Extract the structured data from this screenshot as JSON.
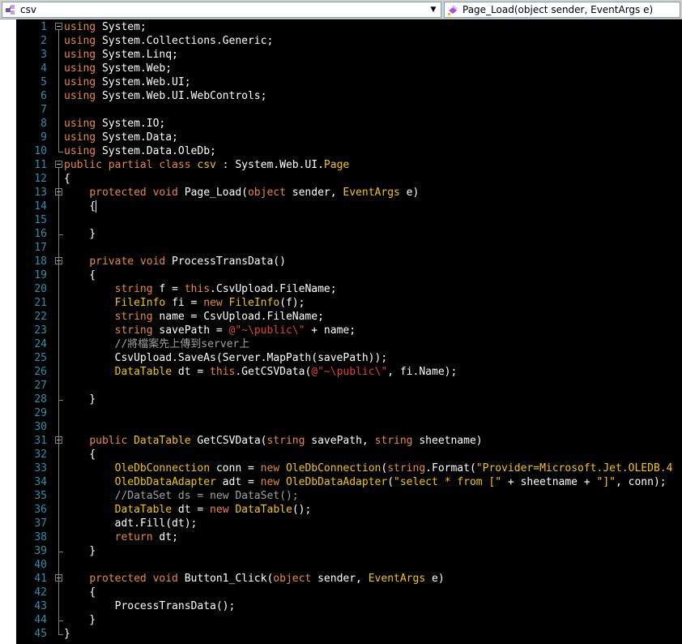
{
  "navigation": {
    "class_selector": {
      "value": "csv",
      "icon": "class-icon"
    },
    "member_selector": {
      "value": "Page_Load(object sender, EventArgs e)",
      "icon": "method-icon"
    }
  },
  "editor": {
    "lines": [
      {
        "n": "1",
        "fold": true,
        "t": [
          [
            "kw",
            "using"
          ],
          [
            "p",
            " System;"
          ]
        ]
      },
      {
        "n": "2",
        "t": [
          [
            "kw",
            "using"
          ],
          [
            "p",
            " System.Collections.Generic;"
          ]
        ]
      },
      {
        "n": "3",
        "t": [
          [
            "kw",
            "using"
          ],
          [
            "p",
            " System.Linq;"
          ]
        ]
      },
      {
        "n": "4",
        "t": [
          [
            "kw",
            "using"
          ],
          [
            "p",
            " System.Web;"
          ]
        ]
      },
      {
        "n": "5",
        "t": [
          [
            "kw",
            "using"
          ],
          [
            "p",
            " System.Web.UI;"
          ]
        ]
      },
      {
        "n": "6",
        "t": [
          [
            "kw",
            "using"
          ],
          [
            "p",
            " System.Web.UI.WebControls;"
          ]
        ]
      },
      {
        "n": "7",
        "t": []
      },
      {
        "n": "8",
        "t": [
          [
            "kw",
            "using"
          ],
          [
            "p",
            " System.IO;"
          ]
        ]
      },
      {
        "n": "9",
        "t": [
          [
            "kw",
            "using"
          ],
          [
            "p",
            " System.Data;"
          ]
        ]
      },
      {
        "n": "10",
        "t": [
          [
            "kw",
            "using"
          ],
          [
            "p",
            " System.Data.OleDb;"
          ]
        ]
      },
      {
        "n": "11",
        "fold": true,
        "t": [
          [
            "kw",
            "public partial class"
          ],
          [
            "p",
            " "
          ],
          [
            "ty",
            "csv"
          ],
          [
            "p",
            " : System.Web.UI."
          ],
          [
            "ty",
            "Page"
          ]
        ]
      },
      {
        "n": "12",
        "t": [
          [
            "p",
            "{"
          ]
        ]
      },
      {
        "n": "13",
        "fold": true,
        "t": [
          [
            "p",
            "    "
          ],
          [
            "kw",
            "protected void"
          ],
          [
            "p",
            " Page_Load("
          ],
          [
            "kw",
            "object"
          ],
          [
            "p",
            " sender, "
          ],
          [
            "ty",
            "EventArgs"
          ],
          [
            "p",
            " e)"
          ]
        ]
      },
      {
        "n": "14",
        "caret": true,
        "t": [
          [
            "p",
            "    {"
          ]
        ]
      },
      {
        "n": "15",
        "t": []
      },
      {
        "n": "16",
        "t": [
          [
            "p",
            "    }"
          ]
        ]
      },
      {
        "n": "17",
        "t": []
      },
      {
        "n": "18",
        "fold": true,
        "t": [
          [
            "p",
            "    "
          ],
          [
            "kw",
            "private void"
          ],
          [
            "p",
            " ProcessTransData()"
          ]
        ]
      },
      {
        "n": "19",
        "t": [
          [
            "p",
            "    {"
          ]
        ]
      },
      {
        "n": "20",
        "t": [
          [
            "p",
            "        "
          ],
          [
            "kw",
            "string"
          ],
          [
            "p",
            " f = "
          ],
          [
            "kw",
            "this"
          ],
          [
            "p",
            ".CsvUpload.FileName;"
          ]
        ]
      },
      {
        "n": "21",
        "t": [
          [
            "p",
            "        "
          ],
          [
            "ty",
            "FileInfo"
          ],
          [
            "p",
            " fi = "
          ],
          [
            "kw",
            "new"
          ],
          [
            "p",
            " "
          ],
          [
            "ty",
            "FileInfo"
          ],
          [
            "p",
            "(f);"
          ]
        ]
      },
      {
        "n": "22",
        "t": [
          [
            "p",
            "        "
          ],
          [
            "kw",
            "string"
          ],
          [
            "p",
            " name = CsvUpload.FileName;"
          ]
        ]
      },
      {
        "n": "23",
        "t": [
          [
            "p",
            "        "
          ],
          [
            "kw",
            "string"
          ],
          [
            "p",
            " savePath = "
          ],
          [
            "verb",
            "@\"~\\public\\\""
          ],
          [
            "p",
            " + name;"
          ]
        ]
      },
      {
        "n": "24",
        "t": [
          [
            "p",
            "        "
          ],
          [
            "cm",
            "//將檔案先上傳到server上"
          ]
        ]
      },
      {
        "n": "25",
        "t": [
          [
            "p",
            "        CsvUpload.SaveAs(Server.MapPath(savePath));"
          ]
        ]
      },
      {
        "n": "26",
        "t": [
          [
            "p",
            "        "
          ],
          [
            "ty",
            "DataTable"
          ],
          [
            "p",
            " dt = "
          ],
          [
            "kw",
            "this"
          ],
          [
            "p",
            ".GetCSVData("
          ],
          [
            "verb",
            "@\"~\\public\\\""
          ],
          [
            "p",
            ", fi.Name);"
          ]
        ]
      },
      {
        "n": "27",
        "t": []
      },
      {
        "n": "28",
        "t": [
          [
            "p",
            "    }"
          ]
        ]
      },
      {
        "n": "29",
        "t": []
      },
      {
        "n": "30",
        "t": []
      },
      {
        "n": "31",
        "fold": true,
        "t": [
          [
            "p",
            "    "
          ],
          [
            "kw",
            "public"
          ],
          [
            "p",
            " "
          ],
          [
            "ty",
            "DataTable"
          ],
          [
            "p",
            " GetCSVData("
          ],
          [
            "kw",
            "string"
          ],
          [
            "p",
            " savePath, "
          ],
          [
            "kw",
            "string"
          ],
          [
            "p",
            " sheetname)"
          ]
        ]
      },
      {
        "n": "32",
        "t": [
          [
            "p",
            "    {"
          ]
        ]
      },
      {
        "n": "33",
        "t": [
          [
            "p",
            "        "
          ],
          [
            "ty",
            "OleDbConnection"
          ],
          [
            "p",
            " conn = "
          ],
          [
            "kw",
            "new"
          ],
          [
            "p",
            " "
          ],
          [
            "ty",
            "OleDbConnection"
          ],
          [
            "p",
            "("
          ],
          [
            "kw",
            "string"
          ],
          [
            "p",
            ".Format("
          ],
          [
            "str",
            "\"Provider=Microsoft.Jet.OLEDB.4"
          ]
        ]
      },
      {
        "n": "34",
        "t": [
          [
            "p",
            "        "
          ],
          [
            "ty",
            "OleDbDataAdapter"
          ],
          [
            "p",
            " adt = "
          ],
          [
            "kw",
            "new"
          ],
          [
            "p",
            " "
          ],
          [
            "ty",
            "OleDbDataAdapter"
          ],
          [
            "p",
            "("
          ],
          [
            "str",
            "\"select * from [\""
          ],
          [
            "p",
            " + sheetname + "
          ],
          [
            "str",
            "\"]\""
          ],
          [
            "p",
            ", conn);"
          ]
        ]
      },
      {
        "n": "35",
        "t": [
          [
            "p",
            "        "
          ],
          [
            "cm",
            "//DataSet ds = new DataSet();"
          ]
        ]
      },
      {
        "n": "36",
        "t": [
          [
            "p",
            "        "
          ],
          [
            "ty",
            "DataTable"
          ],
          [
            "p",
            " dt = "
          ],
          [
            "kw",
            "new"
          ],
          [
            "p",
            " "
          ],
          [
            "ty",
            "DataTable"
          ],
          [
            "p",
            "();"
          ]
        ]
      },
      {
        "n": "37",
        "t": [
          [
            "p",
            "        adt.Fill(dt);"
          ]
        ]
      },
      {
        "n": "38",
        "t": [
          [
            "p",
            "        "
          ],
          [
            "kw",
            "return"
          ],
          [
            "p",
            " dt;"
          ]
        ]
      },
      {
        "n": "39",
        "t": [
          [
            "p",
            "    }"
          ]
        ]
      },
      {
        "n": "40",
        "t": []
      },
      {
        "n": "41",
        "fold": true,
        "t": [
          [
            "p",
            "    "
          ],
          [
            "kw",
            "protected void"
          ],
          [
            "p",
            " Button1_Click("
          ],
          [
            "kw",
            "object"
          ],
          [
            "p",
            " sender, "
          ],
          [
            "ty",
            "EventArgs"
          ],
          [
            "p",
            " e)"
          ]
        ]
      },
      {
        "n": "42",
        "t": [
          [
            "p",
            "    {"
          ]
        ]
      },
      {
        "n": "43",
        "t": [
          [
            "p",
            "        ProcessTransData();"
          ]
        ]
      },
      {
        "n": "44",
        "t": [
          [
            "p",
            "    }"
          ]
        ]
      },
      {
        "n": "45",
        "t": [
          [
            "p",
            "}"
          ]
        ]
      }
    ]
  }
}
